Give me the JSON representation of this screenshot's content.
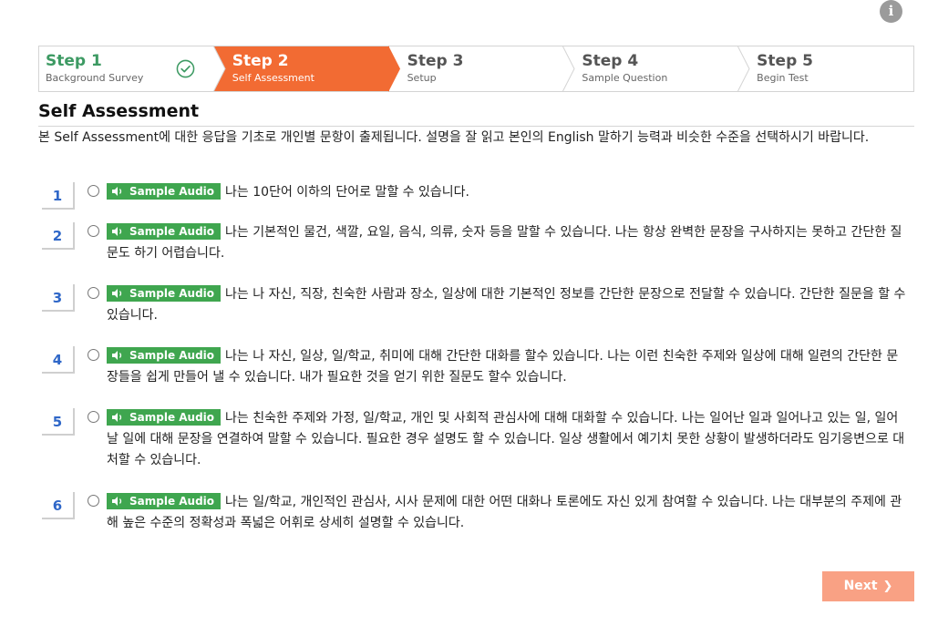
{
  "steps": [
    {
      "title": "Step 1",
      "subtitle": "Background Survey",
      "state": "done"
    },
    {
      "title": "Step 2",
      "subtitle": "Self Assessment",
      "state": "active"
    },
    {
      "title": "Step 3",
      "subtitle": "Setup",
      "state": "pending"
    },
    {
      "title": "Step 4",
      "subtitle": "Sample Question",
      "state": "pending"
    },
    {
      "title": "Step 5",
      "subtitle": "Begin Test",
      "state": "pending"
    }
  ],
  "section": {
    "title": "Self Assessment",
    "description": "본 Self Assessment에 대한 응답을 기초로 개인별 문항이 출제됩니다. 설명을 잘 읽고 본인의 English 말하기 능력과 비슷한 수준을 선택하시기 바랍니다."
  },
  "audio_label": "Sample Audio",
  "options": [
    {
      "number": "1",
      "text": "나는 10단어 이하의 단어로 말할 수 있습니다."
    },
    {
      "number": "2",
      "text": "나는 기본적인 물건, 색깔, 요일, 음식, 의류, 숫자 등을 말할 수 있습니다. 나는 항상 완벽한 문장을 구사하지는 못하고 간단한 질문도 하기 어렵습니다."
    },
    {
      "number": "3",
      "text": "나는 나 자신, 직장, 친숙한 사람과 장소, 일상에 대한 기본적인 정보를 간단한 문장으로 전달할 수 있습니다. 간단한 질문을 할 수 있습니다."
    },
    {
      "number": "4",
      "text": "나는 나 자신, 일상, 일/학교, 취미에 대해 간단한 대화를 할수 있습니다. 나는 이런 친숙한 주제와 일상에 대해 일련의 간단한 문장들을 쉽게 만들어 낼 수 있습니다. 내가 필요한 것을 얻기 위한 질문도 할수 있습니다."
    },
    {
      "number": "5",
      "text": "나는 친숙한 주제와 가정, 일/학교, 개인 및 사회적 관심사에 대해 대화할 수 있습니다. 나는 일어난 일과 일어나고 있는 일, 일어날 일에 대해 문장을 연결하여 말할 수 있습니다. 필요한 경우 설명도 할 수 있습니다. 일상 생활에서 예기치 못한 상황이 발생하더라도 임기응변으로 대처할 수 있습니다."
    },
    {
      "number": "6",
      "text": "나는 일/학교, 개인적인 관심사, 시사 문제에 대한 어떤 대화나 토론에도 자신 있게 참여할 수 있습니다. 나는 대부분의 주제에 관해 높은 수준의 정확성과 폭넓은 어휘로 상세히 설명할 수 있습니다."
    }
  ],
  "next_label": "Next",
  "info_label": "i",
  "colors": {
    "active_step": "#f26b33",
    "done_step": "#3d9a63",
    "audio_button": "#3fa64f",
    "option_number": "#2f67c8",
    "next_button": "#f9a184"
  }
}
